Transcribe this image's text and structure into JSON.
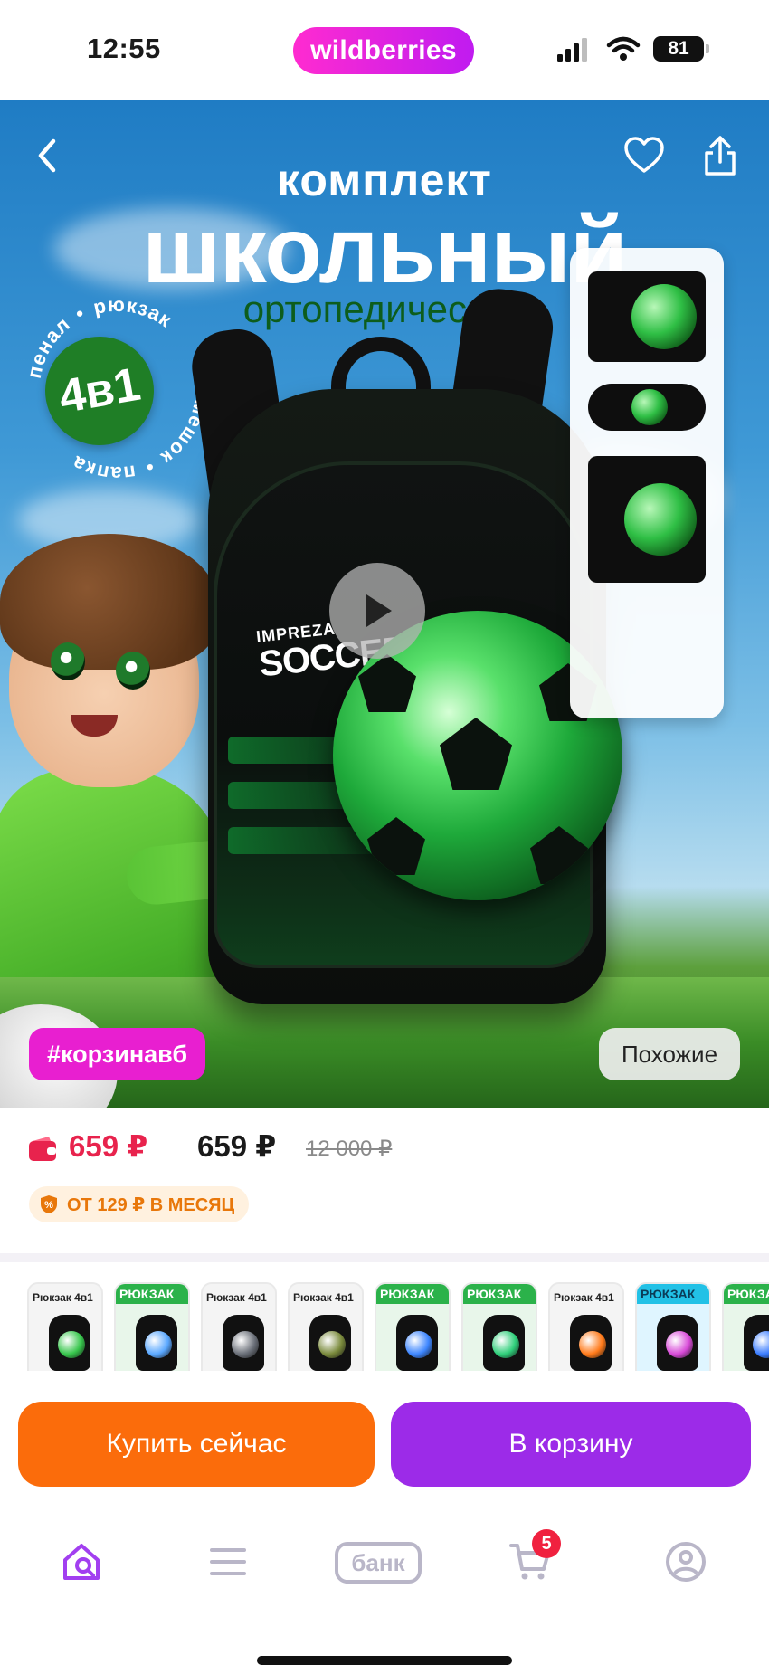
{
  "status_bar": {
    "time": "12:55",
    "app_brand": "wildberries",
    "battery": "81",
    "icons": [
      "cellular-signal-icon",
      "wifi-icon",
      "battery-icon"
    ]
  },
  "hero": {
    "title_small": "комплект",
    "title_big": "школьный",
    "subtitle": "ортопедический",
    "kit_badge": "4в1",
    "kit_ring_words": [
      "пенал",
      "рюкзак",
      "мешок",
      "папка"
    ],
    "product_label_small": "IMPREZA",
    "product_label_big": "SOCCER",
    "tag": "#корзинавб",
    "similar_button": "Похожие",
    "icons": [
      "back-arrow-icon",
      "heart-icon",
      "share-icon",
      "play-icon"
    ]
  },
  "price": {
    "wallet_price": "659 ₽",
    "price": "659 ₽",
    "old_price": "12 000 ₽",
    "installment": "ОТ 129 ₽ В МЕСЯЦ"
  },
  "thumbnails": [
    {
      "title": "Рюкзак 4в1",
      "style": "plain",
      "ball": "#37c64c"
    },
    {
      "title": "РЮКЗАК",
      "style": "green-head",
      "ball": "#5aa8ff"
    },
    {
      "title": "Рюкзак 4в1",
      "style": "plain",
      "ball": "#6a6f78"
    },
    {
      "title": "Рюкзак 4в1",
      "style": "plain",
      "ball": "#7a8a3c"
    },
    {
      "title": "РЮКЗАК",
      "style": "green-head",
      "ball": "#3d86ff"
    },
    {
      "title": "РЮКЗАК",
      "style": "green-head",
      "ball": "#2fcf7a"
    },
    {
      "title": "Рюкзак 4в1",
      "style": "plain",
      "ball": "#ff7a1a"
    },
    {
      "title": "РЮКЗАК",
      "style": "cyan-head",
      "ball": "#d84ad8"
    },
    {
      "title": "РЮКЗА",
      "style": "green-head",
      "ball": "#3a7cff"
    }
  ],
  "actions": {
    "buy_now": "Купить сейчас",
    "add_to_cart": "В корзину"
  },
  "bottom_nav": {
    "bank_label": "банк",
    "cart_count": "5",
    "items": [
      "home-icon",
      "catalog-icon",
      "bank-icon",
      "cart-icon",
      "profile-icon"
    ]
  },
  "colors": {
    "brand_gradient_start": "#ff2bd0",
    "brand_gradient_end": "#c01bf0",
    "buy_button": "#fb6c0b",
    "cart_button": "#9c2be8",
    "wallet_price": "#e8234d",
    "tag": "#e81fd0",
    "installment_text": "#e8770a"
  }
}
